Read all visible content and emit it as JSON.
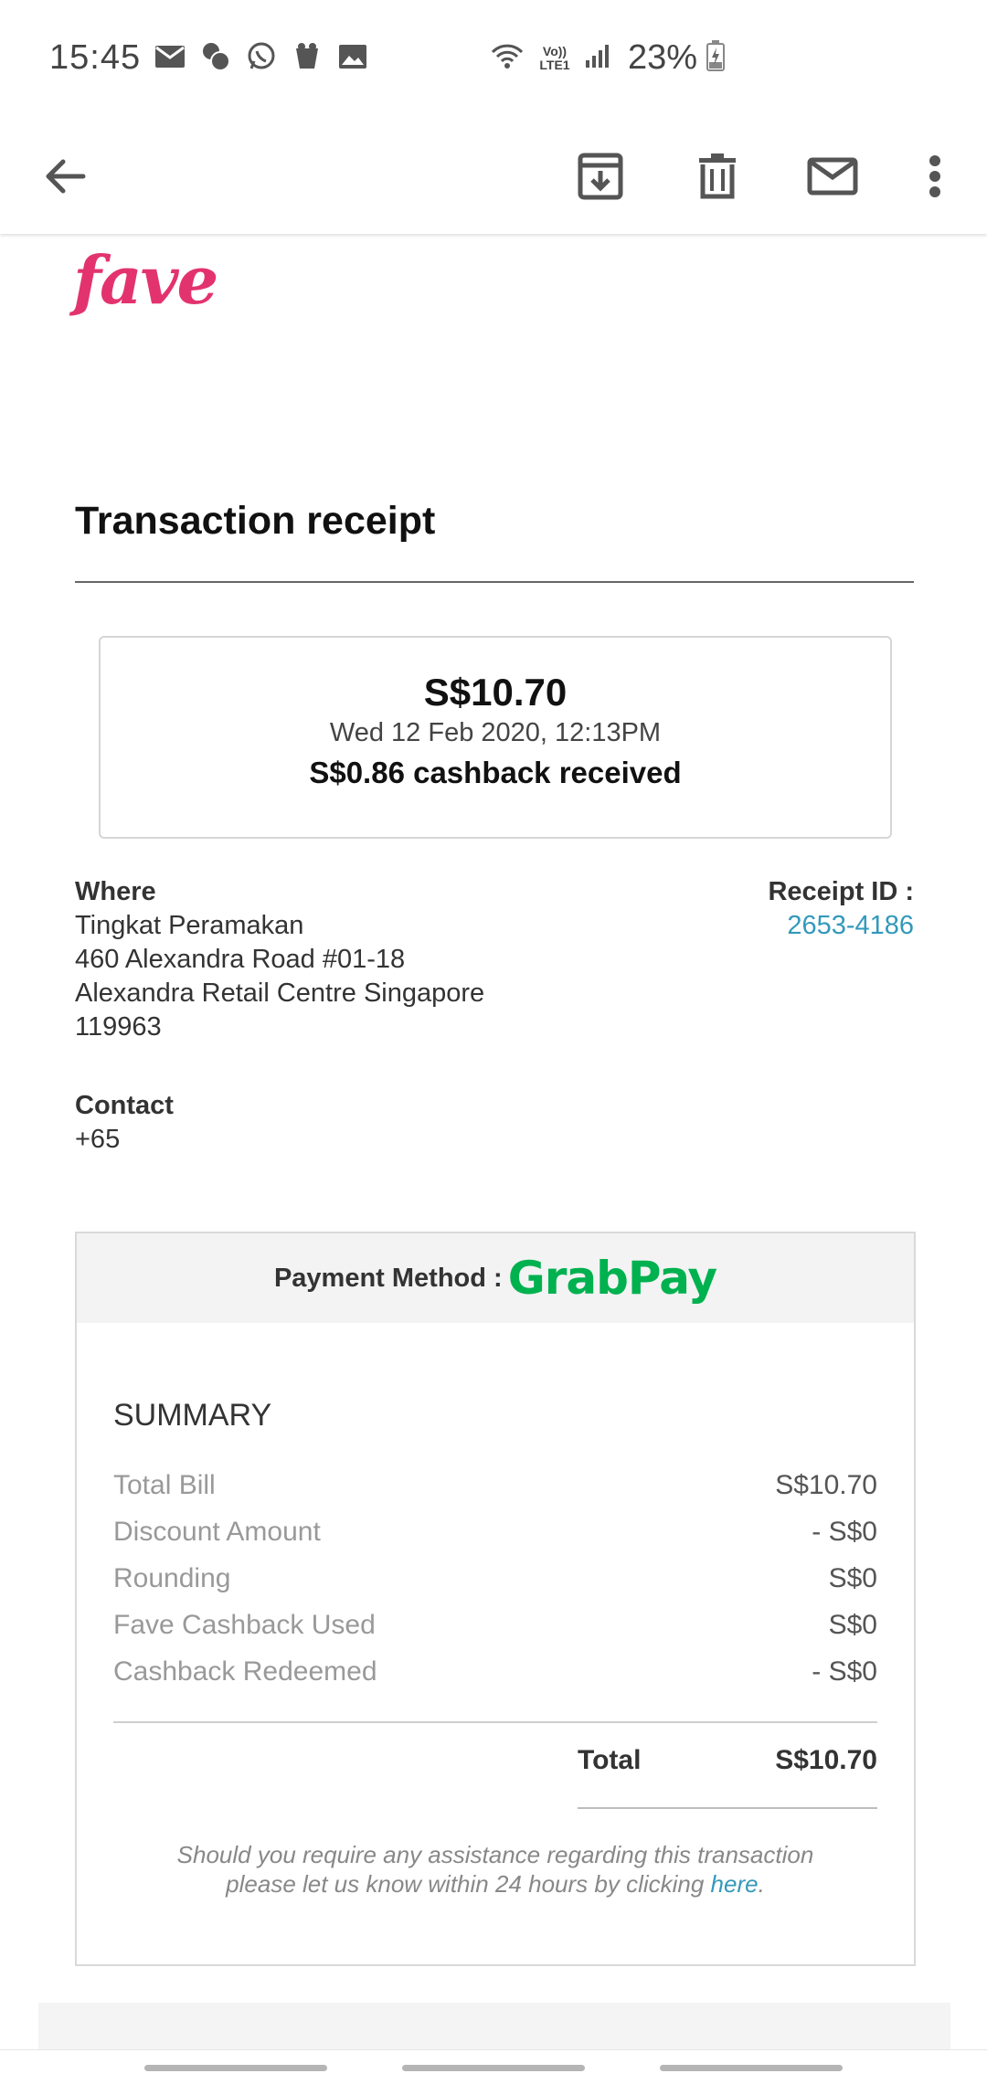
{
  "status_bar": {
    "time": "15:45",
    "notification_icons": [
      "mail-icon",
      "chat-bubbles-icon",
      "whatsapp-icon",
      "game-icon",
      "gallery-icon"
    ],
    "vo_lte": "Vo)) LTE1",
    "battery": "23%"
  },
  "app_bar": {
    "actions": [
      "archive-icon",
      "delete-icon",
      "mail-icon",
      "more-vert-icon"
    ]
  },
  "email": {
    "brand": "fave",
    "title": "Transaction receipt",
    "amount": "S$10.70",
    "date": "Wed 12 Feb 2020, 12:13PM",
    "cashback": "S$0.86 cashback received",
    "where_label": "Where",
    "merchant_name": "Tingkat Peramakan",
    "address_line1": "460 Alexandra Road #01-18",
    "address_line2": "Alexandra Retail Centre Singapore",
    "postcode": "119963",
    "receipt_label": "Receipt ID :",
    "receipt_id": "2653-4186",
    "contact_label": "Contact",
    "contact_value": "+65",
    "payment_label": "Payment Method :",
    "payment_brand": "GrabPay",
    "summary_title": "SUMMARY",
    "summary_rows": [
      {
        "label": "Total Bill",
        "value": "S$10.70"
      },
      {
        "label": "Discount Amount",
        "value": "- S$0"
      },
      {
        "label": "Rounding",
        "value": "S$0"
      },
      {
        "label": "Fave Cashback Used",
        "value": "S$0"
      },
      {
        "label": "Cashback Redeemed",
        "value": "- S$0"
      }
    ],
    "total_label": "Total",
    "total_value": "S$10.70",
    "assist_line1": "Should you require any assistance regarding this transaction",
    "assist_line2": "please let us know within 24 hours by clicking ",
    "assist_link": "here",
    "assist_end": "."
  },
  "colors": {
    "brand_pink": "#e3336f",
    "link_blue": "#3399bb",
    "grabpay_green": "#00b14f"
  }
}
